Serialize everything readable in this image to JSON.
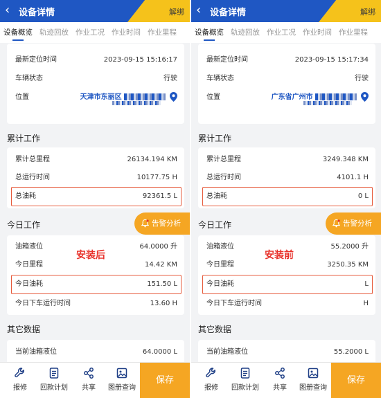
{
  "header": {
    "title": "设备详情",
    "unbind_label": "解绑",
    "back_glyph": "‹"
  },
  "tabs": [
    "设备概览",
    "轨迹回放",
    "作业工况",
    "作业时间",
    "作业里程"
  ],
  "labels": {
    "location_time": "最新定位时间",
    "vehicle_status": "车辆状态",
    "location": "位置",
    "cumulative_title": "累计工作",
    "total_mileage": "累计总里程",
    "total_runtime": "总运行时间",
    "total_fuel": "总油耗",
    "today_title": "今日工作",
    "tank_level": "油箱液位",
    "today_mileage": "今日里程",
    "today_fuel": "今日油耗",
    "today_offline_runtime": "今日下车运行时间",
    "other_title": "其它数据",
    "current_tank_level": "当前油箱液位",
    "alarm_label": "告警分析"
  },
  "bottom_bar": {
    "items": [
      {
        "label": "报修",
        "icon": "wrench-icon"
      },
      {
        "label": "回款计划",
        "icon": "document-icon"
      },
      {
        "label": "共享",
        "icon": "share-icon"
      },
      {
        "label": "图册查询",
        "icon": "album-icon"
      }
    ],
    "save_label": "保存"
  },
  "left": {
    "location_time": "2023-09-15 15:16:17",
    "vehicle_status": "行驶",
    "address": "天津市东丽区",
    "total_mileage": "26134.194 KM",
    "total_runtime": "10177.75 H",
    "total_fuel": "92361.5 L",
    "tank_level": "64.0000 升",
    "today_mileage": "14.42 KM",
    "today_fuel": "151.50 L",
    "today_offline_runtime": "13.60 H",
    "current_tank_level": "64.0000 L",
    "tag": "安装后"
  },
  "right": {
    "location_time": "2023-09-15 15:17:34",
    "vehicle_status": "行驶",
    "address": "广东省广州市",
    "total_mileage": "3249.348 KM",
    "total_runtime": "4101.1 H",
    "total_fuel": "0 L",
    "tank_level": "55.2000 升",
    "today_mileage": "3250.35 KM",
    "today_fuel": "L",
    "today_offline_runtime": "H",
    "current_tank_level": "55.2000 L",
    "tag": "安装前"
  },
  "colors": {
    "primary": "#1f57c3",
    "accent": "#f5c21b",
    "orange": "#f5a623",
    "highlight": "#e65a3b",
    "tag_red": "#e8322b"
  }
}
